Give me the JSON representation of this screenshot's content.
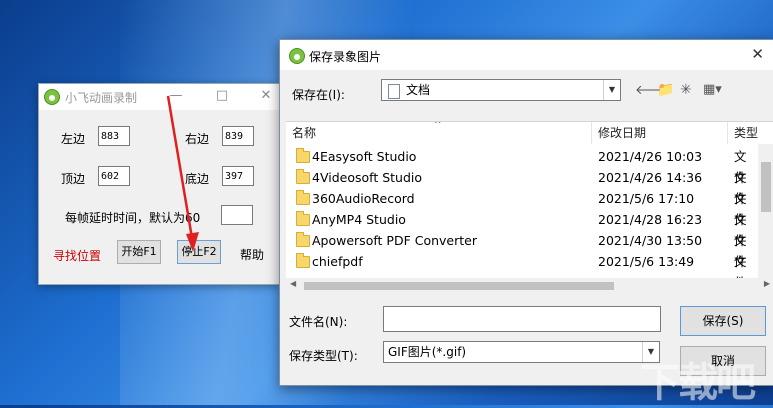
{
  "recorder": {
    "title": "小飞动画录制",
    "minimize_glyph": "—",
    "maximize_glyph": "□",
    "close_glyph": "✕",
    "left_label": "左边",
    "left_value": "883",
    "right_label": "右边",
    "right_value": "839",
    "top_label": "顶边",
    "top_value": "602",
    "bottom_label": "底边",
    "bottom_value": "397",
    "delay_label": "每帧延时时间，默认为60",
    "delay_value": "",
    "find_label": "寻找位置",
    "start_label": "开始F1",
    "stop_label": "停止F2",
    "help_label": "帮助",
    "find_color": "#cc0000"
  },
  "dialog": {
    "title": "保存录象图片",
    "close_glyph": "✕",
    "save_in_label": "保存在(I):",
    "save_in_value": "文档",
    "columns": [
      "名称",
      "修改日期",
      "类型"
    ],
    "files": [
      {
        "name": "4Easysoft Studio",
        "date": "2021/4/26 10:03",
        "type": "文件"
      },
      {
        "name": "4Videosoft Studio",
        "date": "2021/4/26 14:36",
        "type": "文件"
      },
      {
        "name": "360AudioRecord",
        "date": "2021/5/6 17:10",
        "type": "文件"
      },
      {
        "name": "AnyMP4 Studio",
        "date": "2021/4/28 16:23",
        "type": "文件"
      },
      {
        "name": "Apowersoft PDF Converter",
        "date": "2021/4/30 13:50",
        "type": "文件"
      },
      {
        "name": "chiefpdf",
        "date": "2021/5/6 13:49",
        "type": "文件"
      }
    ],
    "filename_label": "文件名(N):",
    "filename_value": "",
    "filetype_label": "保存类型(T):",
    "filetype_value": "GIF图片(*.gif)",
    "save_button": "保存(S)",
    "cancel_button": "取消"
  },
  "icons": [
    "back-arrow-icon",
    "up-folder-icon",
    "new-folder-icon",
    "view-menu-icon",
    "document-icon",
    "folder-icon",
    "app-icon"
  ],
  "accent_arrow": "#e02020",
  "watermark": "下载吧"
}
